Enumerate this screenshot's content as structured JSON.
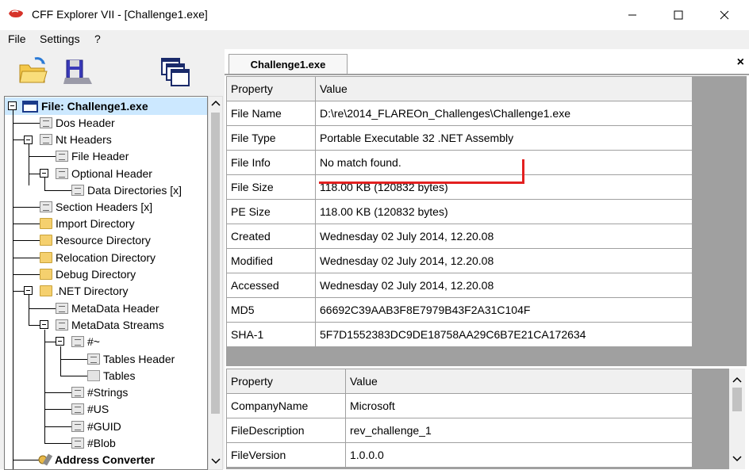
{
  "window": {
    "title": "CFF Explorer VII - [Challenge1.exe]"
  },
  "menu": {
    "items": [
      "File",
      "Settings",
      "?"
    ]
  },
  "tabs": {
    "active": "Challenge1.exe"
  },
  "tree": {
    "root": "File: Challenge1.exe",
    "items": {
      "dos_header": "Dos Header",
      "nt_headers": "Nt Headers",
      "file_header": "File Header",
      "optional_header": "Optional Header",
      "data_directories": "Data Directories [x]",
      "section_headers": "Section Headers [x]",
      "import_directory": "Import Directory",
      "resource_directory": "Resource Directory",
      "relocation_directory": "Relocation Directory",
      "debug_directory": "Debug Directory",
      "net_directory": ".NET Directory",
      "metadata_header": "MetaData Header",
      "metadata_streams": "MetaData Streams",
      "tilde": "#~",
      "tables_header": "Tables Header",
      "tables": "Tables",
      "strings": "#Strings",
      "us": "#US",
      "guid": "#GUID",
      "blob": "#Blob",
      "address_converter": "Address Converter"
    }
  },
  "file_props": {
    "header": {
      "property": "Property",
      "value": "Value"
    },
    "rows": [
      {
        "property": "File Name",
        "value": "D:\\re\\2014_FLAREOn_Challenges\\Challenge1.exe"
      },
      {
        "property": "File Type",
        "value": "Portable Executable 32 .NET Assembly"
      },
      {
        "property": "File Info",
        "value": "No match found."
      },
      {
        "property": "File Size",
        "value": "118.00 KB (120832 bytes)"
      },
      {
        "property": "PE Size",
        "value": "118.00 KB (120832 bytes)"
      },
      {
        "property": "Created",
        "value": "Wednesday 02 July 2014, 12.20.08"
      },
      {
        "property": "Modified",
        "value": "Wednesday 02 July 2014, 12.20.08"
      },
      {
        "property": "Accessed",
        "value": "Wednesday 02 July 2014, 12.20.08"
      },
      {
        "property": "MD5",
        "value": "66692C39AAB3F8E7979B43F2A31C104F"
      },
      {
        "property": "SHA-1",
        "value": "5F7D1552383DC9DE18758AA29C6B7E21CA172634"
      }
    ]
  },
  "version_props": {
    "header": {
      "property": "Property",
      "value": "Value"
    },
    "rows": [
      {
        "property": "CompanyName",
        "value": "Microsoft"
      },
      {
        "property": "FileDescription",
        "value": "rev_challenge_1"
      },
      {
        "property": "FileVersion",
        "value": "1.0.0.0"
      }
    ]
  },
  "colors": {
    "highlight": "#cce8ff",
    "annotation": "#e32020"
  }
}
